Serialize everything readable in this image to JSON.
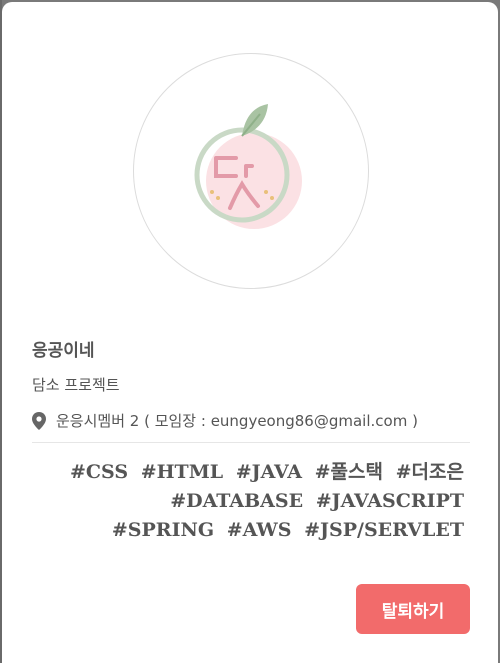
{
  "group": {
    "name": "응공이네",
    "type": "담소 프로젝트",
    "location": "운응시멤버 2 ( 모임장 : eungyeong86@gmail.com )"
  },
  "tags": [
    "#CSS",
    "#HTML",
    "#JAVA",
    "#풀스택",
    "#더조은",
    "#DATABASE",
    "#JAVASCRIPT",
    "#SPRING",
    "#AWS",
    "#JSP/SERVLET"
  ],
  "actions": {
    "leave_label": "탈퇴하기"
  },
  "colors": {
    "accent": "#f26b6b",
    "text": "#555555"
  },
  "icons": {
    "location": "map-pin-icon",
    "avatar": "peach-logo"
  }
}
